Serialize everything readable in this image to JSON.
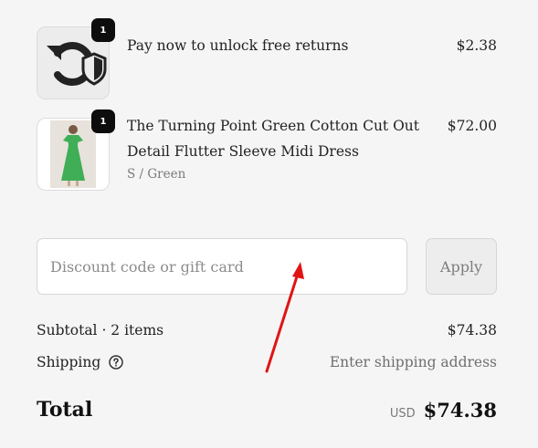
{
  "items": [
    {
      "title": "Pay now to unlock free returns",
      "price": "$2.38",
      "quantity": "1",
      "icon": "refresh-shield-icon"
    },
    {
      "title": "The Turning Point Green Cotton Cut Out Detail Flutter Sleeve Midi Dress",
      "variant": "S / Green",
      "price": "$72.00",
      "quantity": "1",
      "image": "green-dress-thumbnail"
    }
  ],
  "discount": {
    "placeholder": "Discount code or gift card",
    "value": "",
    "apply_label": "Apply"
  },
  "summary": {
    "subtotal_label": "Subtotal · 2 items",
    "subtotal_value": "$74.38",
    "shipping_label": "Shipping",
    "shipping_value": "Enter shipping address",
    "total_label": "Total",
    "currency": "USD",
    "total_value": "$74.38"
  },
  "colors": {
    "annotation_arrow": "#e01414",
    "dress_green": "#3fae56",
    "badge": "#0d0d0d"
  }
}
